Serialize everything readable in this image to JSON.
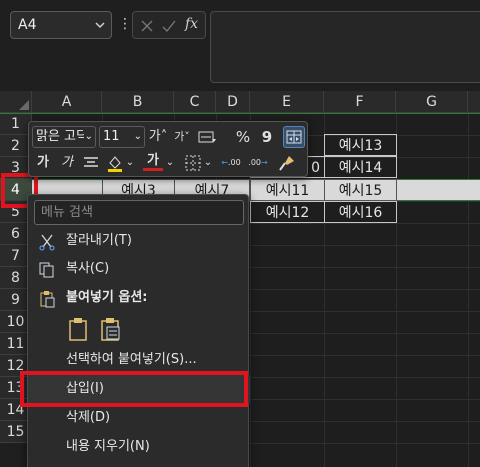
{
  "name_box": {
    "value": "A4"
  },
  "formula_bar": {
    "fx_label": "fx",
    "value": ""
  },
  "columns": [
    "A",
    "B",
    "C",
    "D",
    "E",
    "F",
    "G"
  ],
  "rows": [
    "1",
    "2",
    "3",
    "4",
    "5",
    "6",
    "7",
    "8",
    "9",
    "10",
    "11",
    "12",
    "13",
    "14",
    "15"
  ],
  "selected_row": "4",
  "cells": {
    "e2": "",
    "f2": "예시13",
    "e3": "0",
    "f3": "예시14",
    "b4": "예시3",
    "c4": "예시7",
    "e4": "예시11",
    "f4": "예시15",
    "e5": "예시12",
    "f5": "예시16"
  },
  "mini_toolbar": {
    "font_name": "맑은 고딕",
    "font_size": "11",
    "grow_font": "가˄",
    "shrink_font": "가˅",
    "bold": "가",
    "italic": "가",
    "font_color_glyph": "가",
    "percent": "%",
    "comma": "9",
    "inc_decimal": ".00",
    "dec_decimal": ".00"
  },
  "context_menu": {
    "search_placeholder": "메뉴 검색",
    "items": [
      {
        "label": "잘라내기(T)",
        "icon": "scissors-icon"
      },
      {
        "label": "복사(C)",
        "icon": "copy-icon"
      },
      {
        "label": "붙여넣기 옵션:",
        "icon": "paste-icon"
      },
      {
        "label": "선택하여 붙여넣기(S)...",
        "icon": ""
      },
      {
        "label": "삽입(I)",
        "icon": ""
      },
      {
        "label": "삭제(D)",
        "icon": ""
      },
      {
        "label": "내용 지우기(N)",
        "icon": ""
      }
    ]
  },
  "colors": {
    "highlight": "#e0141e",
    "selection_green": "#2e7d32",
    "accent_blue": "#4f86c6"
  }
}
